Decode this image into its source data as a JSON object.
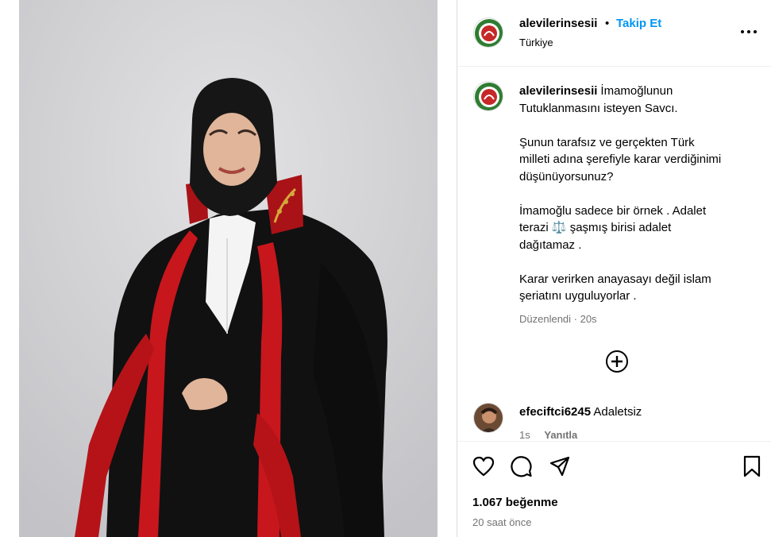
{
  "post": {
    "username": "alevilerinsesii",
    "follow_label": "Takip Et",
    "separator": "•",
    "location": "Türkiye",
    "caption": {
      "line1": "İmamoğlunun",
      "line2": "Tutuklanmasını isteyen Savcı.",
      "p2_line1": "Şunun tarafsız ve gerçekten Türk",
      "p2_line2": "milleti adına şerefiyle karar verdiğinimi",
      "p2_line3": "düşünüyorsunuz?",
      "p3_line1": "İmamoğlu sadece bir örnek . Adalet",
      "p3_line2": "terazi ⚖️ şaşmış birisi adalet",
      "p3_line3": "dağıtamaz .",
      "p4_line1": "Karar verirken anayasayı değil islam",
      "p4_line2": "şeriatını uyguluyorlar ."
    },
    "edited_label": "Düzenlendi · 20s",
    "likes": "1.067 beğenme",
    "time_ago": "20 saat önce"
  },
  "comments": [
    {
      "username": "efeciftci6245",
      "text": "Adaletsiz",
      "time": "1s",
      "reply_label": "Yanıtla"
    }
  ],
  "icons": {
    "more": "more-options-icon",
    "load_more": "plus-circle-icon",
    "like": "heart-icon",
    "comment": "comment-icon",
    "share": "share-icon",
    "save": "bookmark-icon"
  },
  "colors": {
    "accent": "#0095f6",
    "robe_red": "#c8161d",
    "robe_black": "#111111"
  }
}
